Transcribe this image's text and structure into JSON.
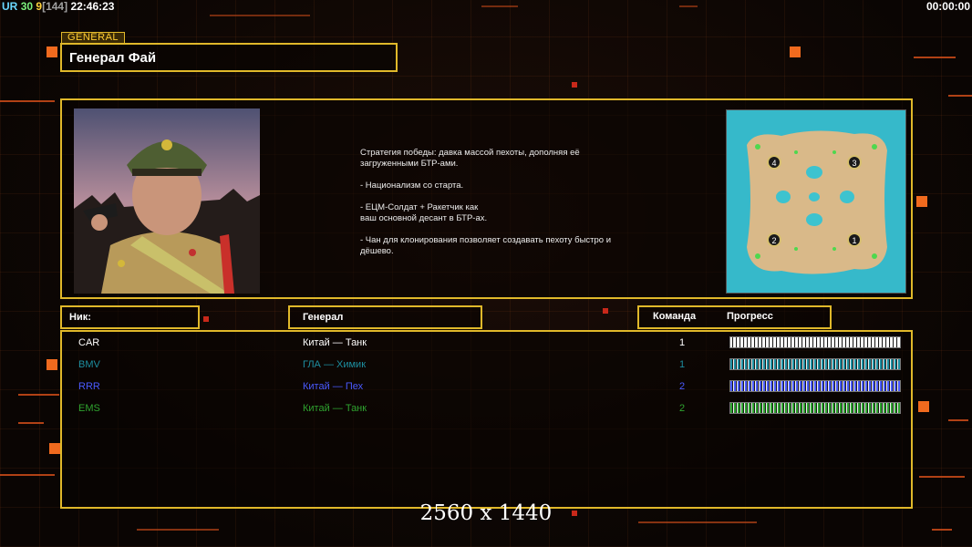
{
  "hud": {
    "ur": "UR",
    "n30": "30",
    "n9": "9",
    "n144": "[144]",
    "time": "22:46:23",
    "timer": "00:00:00"
  },
  "general_tag": "GENERAL",
  "general_name": "Генерал Фай",
  "description": "Стратегия победы: давка массой пехоты, дополняя её\n загруженными БТР-ами.\n\n- Национализм со старта.\n\n- ЕЦМ-Солдат + Ракетчик как\nваш основной десант в БТР-ах.\n\n- Чан для клонирования позволяет создавать пехоту быстро и\n дёшево.",
  "map": {
    "starts": [
      "4",
      "3",
      "2",
      "1"
    ]
  },
  "headers": {
    "nick": "Ник:",
    "general": "Генерал",
    "team": "Команда",
    "progress": "Прогресс"
  },
  "players": [
    {
      "nick": "CAR",
      "general": "Китай — Танк",
      "team": "1",
      "color": "#ffffff",
      "progress": 1.0
    },
    {
      "nick": "BMV",
      "general": "ГЛА — Химик",
      "team": "1",
      "color": "#1d8ea0",
      "progress": 1.0
    },
    {
      "nick": "RRR",
      "general": "Китай — Пех",
      "team": "2",
      "color": "#4a5aff",
      "progress": 1.0
    },
    {
      "nick": "EMS",
      "general": "Китай — Танк",
      "team": "2",
      "color": "#2fa32f",
      "progress": 1.0
    }
  ],
  "resolution": "2560 x 1440"
}
